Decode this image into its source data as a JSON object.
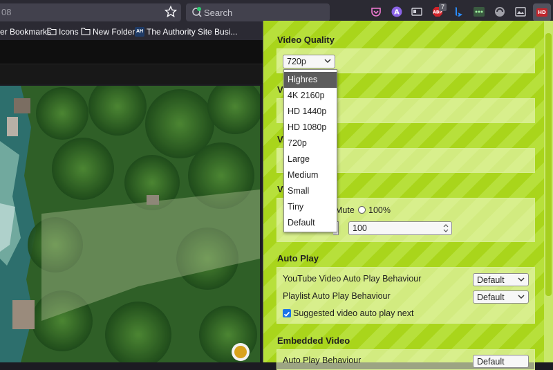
{
  "browser": {
    "url_fragment": "08",
    "search_placeholder": "Search",
    "abp_badge": "7",
    "hd_ext_label": "HD",
    "bookmarks": [
      {
        "label": "er Bookmarks"
      },
      {
        "label": "Icons"
      },
      {
        "label": "New Folder"
      },
      {
        "label": "The Authority Site Busi..."
      }
    ],
    "ah_badge": "AH"
  },
  "popup": {
    "video_quality": {
      "title": "Video Quality",
      "selected": "720p",
      "options": [
        "Highres",
        "4K 2160p",
        "HD 1440p",
        "HD 1080p",
        "720p",
        "Large",
        "Medium",
        "Small",
        "Tiny",
        "Default"
      ],
      "highlighted_index": 0
    },
    "hidden_titles": [
      "V",
      "V",
      "V"
    ],
    "volume": {
      "mute_label": "Mute",
      "full_label": "100%",
      "value": "100"
    },
    "auto_play": {
      "title": "Auto Play",
      "rows": [
        {
          "label": "YouTube Video Auto Play Behaviour",
          "value": "Default"
        },
        {
          "label": "Playlist Auto Play Behaviour",
          "value": "Default"
        }
      ],
      "checkbox_label": "Suggested video auto play next"
    },
    "embedded": {
      "title": "Embedded Video",
      "row_label": "Auto Play Behaviour",
      "row_value": "Default"
    }
  },
  "colors": {
    "popup_green": "#a9d51b",
    "toolbar": "#2b2a33",
    "checkbox_blue": "#1a73e8"
  }
}
